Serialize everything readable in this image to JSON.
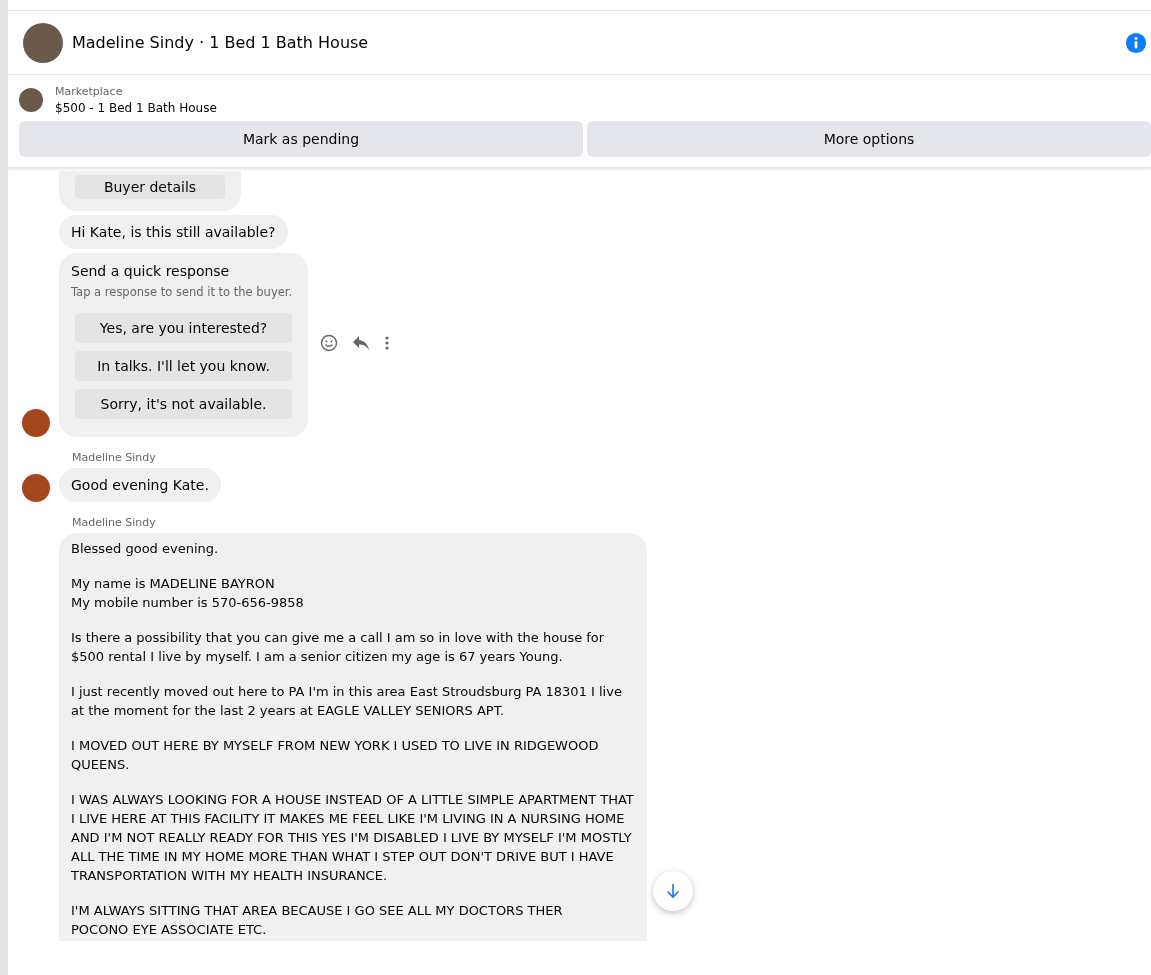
{
  "header": {
    "title": "Madeline Sindy · 1 Bed 1 Bath House"
  },
  "listing": {
    "source": "Marketplace",
    "title": "$500 - 1 Bed 1 Bath House",
    "actions": [
      "Mark as pending",
      "More options"
    ]
  },
  "messages": [
    {
      "kind": "buttons",
      "buttons": [
        "Buyer details"
      ],
      "avatar": false
    },
    {
      "kind": "text",
      "text": "Hi Kate, is this still available?",
      "avatar": false
    },
    {
      "kind": "quick",
      "title": "Send a quick response",
      "subtitle": "Tap a response to send it to the buyer.",
      "buttons": [
        "Yes, are you interested?",
        "In talks. I'll let you know.",
        "Sorry, it's not available."
      ],
      "avatar": true
    },
    {
      "kind": "text",
      "sender": "Madeline Sindy",
      "text": "Good evening Kate.",
      "avatar": true
    },
    {
      "kind": "long",
      "sender": "Madeline Sindy",
      "paragraphs": [
        "Blessed good evening.",
        "My name is MADELINE BAYRON\nMy mobile number is 570-656-9858",
        "Is there a possibility that you can give me a call I am so in love with the house for $500 rental I live by myself. I am a senior citizen my age is 67 years Young.",
        "I just recently moved out here to PA I'm in this area East Stroudsburg PA 18301 I live at the moment for the last 2 years at EAGLE VALLEY SENIORS  APT.",
        "I MOVED OUT HERE BY MYSELF FROM NEW YORK I USED TO LIVE IN RIDGEWOOD QUEENS.",
        "I WAS ALWAYS LOOKING FOR A HOUSE INSTEAD OF A LITTLE SIMPLE APARTMENT THAT I LIVE HERE AT THIS FACILITY IT MAKES ME FEEL LIKE I'M LIVING IN A NURSING HOME AND I'M NOT REALLY READY FOR THIS YES I'M DISABLED I LIVE BY MYSELF I'M MOSTLY ALL THE TIME IN MY HOME MORE THAN WHAT I STEP OUT DON'T DRIVE BUT I HAVE TRANSPORTATION WITH MY  HEALTH INSURANCE.",
        "I'M ALWAYS SITTING THAT AREA BECAUSE I GO SEE ALL MY DOCTORS THER\nPOCONO EYE ASSOCIATE ETC."
      ],
      "avatar": false
    }
  ]
}
